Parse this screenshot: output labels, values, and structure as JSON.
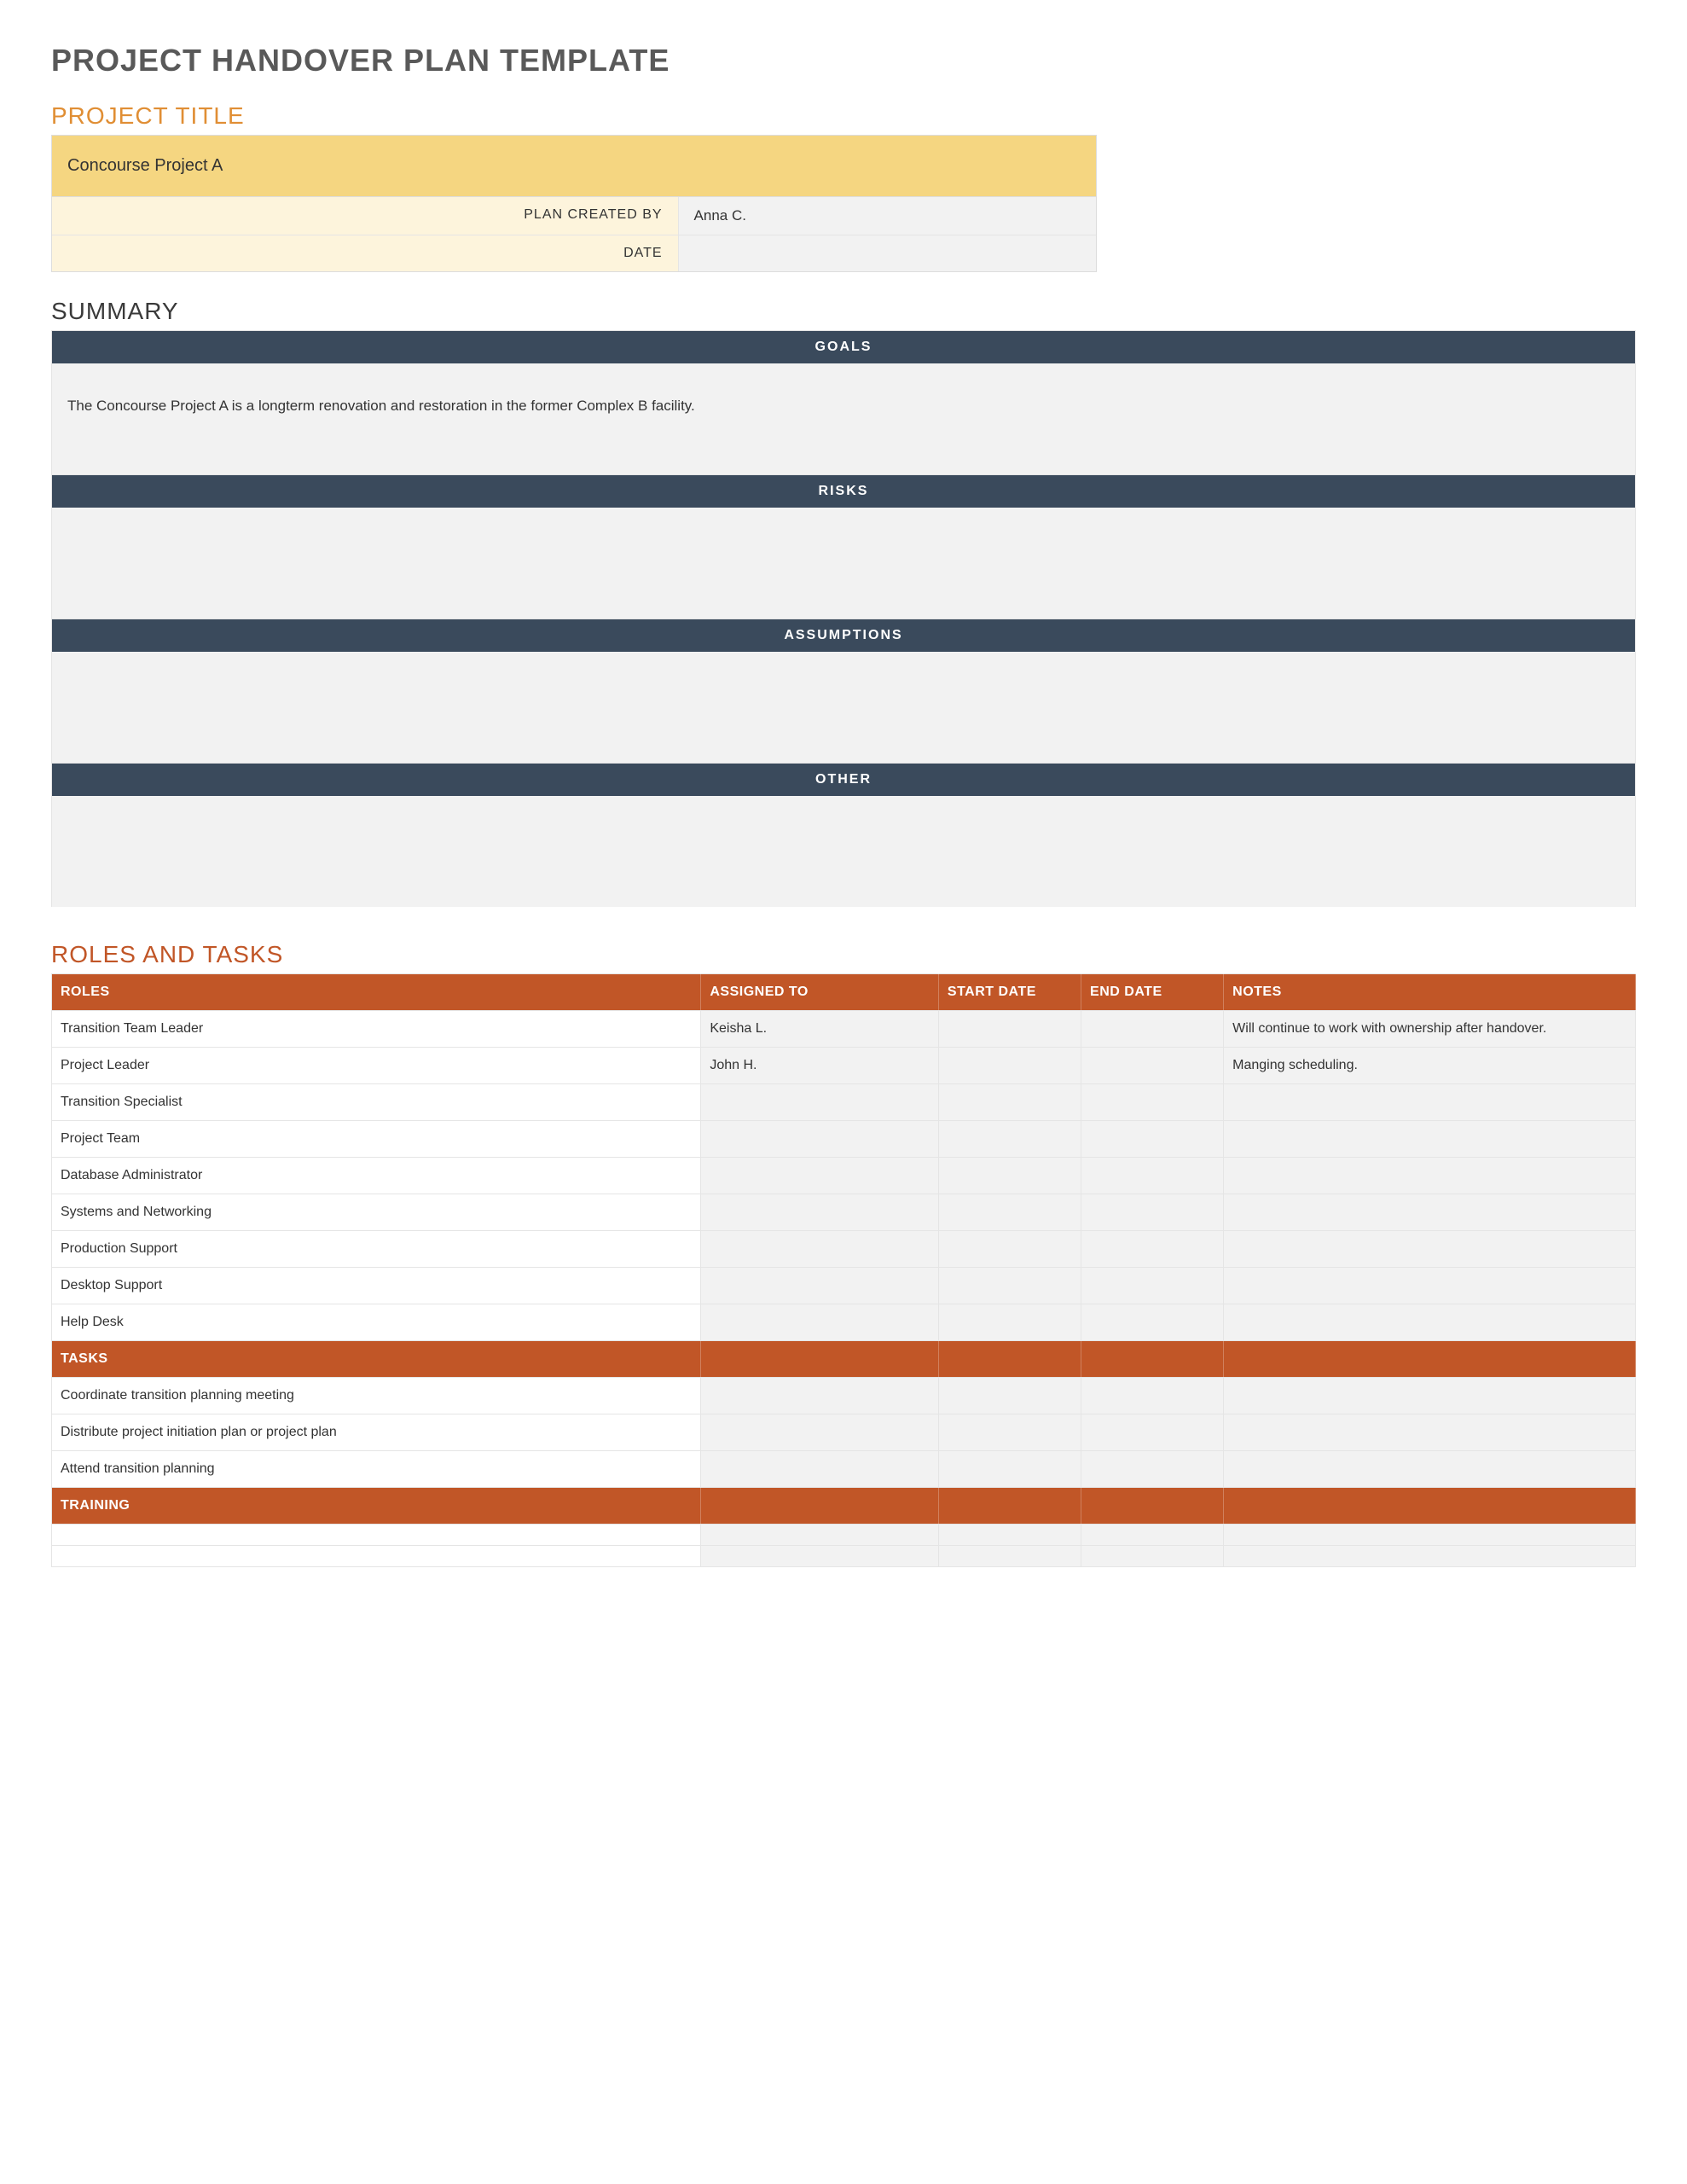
{
  "main_title": "PROJECT HANDOVER PLAN TEMPLATE",
  "project_title_label": "PROJECT TITLE",
  "project_name": "Concourse Project A",
  "meta": {
    "plan_created_by_label": "PLAN CREATED BY",
    "plan_created_by_value": "Anna C.",
    "date_label": "DATE",
    "date_value": ""
  },
  "summary": {
    "heading": "SUMMARY",
    "goals_label": "GOALS",
    "goals_text": "The Concourse Project A is a longterm renovation and restoration in the former Complex B facility.",
    "risks_label": "RISKS",
    "risks_text": "",
    "assumptions_label": "ASSUMPTIONS",
    "assumptions_text": "",
    "other_label": "OTHER",
    "other_text": ""
  },
  "roles_section": {
    "heading": "ROLES AND TASKS",
    "headers": {
      "roles": "ROLES",
      "assigned": "ASSIGNED TO",
      "start": "START DATE",
      "end": "END DATE",
      "notes": "NOTES"
    },
    "roles": [
      {
        "role": "Transition Team Leader",
        "assigned": "Keisha L.",
        "start": "",
        "end": "",
        "notes": "Will continue to work with ownership after handover."
      },
      {
        "role": "Project Leader",
        "assigned": "John H.",
        "start": "",
        "end": "",
        "notes": "Manging scheduling."
      },
      {
        "role": "Transition Specialist",
        "assigned": "",
        "start": "",
        "end": "",
        "notes": ""
      },
      {
        "role": "Project Team",
        "assigned": "",
        "start": "",
        "end": "",
        "notes": ""
      },
      {
        "role": "Database Administrator",
        "assigned": "",
        "start": "",
        "end": "",
        "notes": ""
      },
      {
        "role": "Systems and Networking",
        "assigned": "",
        "start": "",
        "end": "",
        "notes": ""
      },
      {
        "role": "Production Support",
        "assigned": "",
        "start": "",
        "end": "",
        "notes": ""
      },
      {
        "role": "Desktop Support",
        "assigned": "",
        "start": "",
        "end": "",
        "notes": ""
      },
      {
        "role": "Help Desk",
        "assigned": "",
        "start": "",
        "end": "",
        "notes": ""
      }
    ],
    "tasks_label": "TASKS",
    "tasks": [
      {
        "role": "Coordinate transition planning meeting",
        "assigned": "",
        "start": "",
        "end": "",
        "notes": ""
      },
      {
        "role": "Distribute project initiation plan or project plan",
        "assigned": "",
        "start": "",
        "end": "",
        "notes": ""
      },
      {
        "role": "Attend transition planning",
        "assigned": "",
        "start": "",
        "end": "",
        "notes": ""
      }
    ],
    "training_label": "TRAINING",
    "training": [
      {
        "role": "",
        "assigned": "",
        "start": "",
        "end": "",
        "notes": ""
      },
      {
        "role": "",
        "assigned": "",
        "start": "",
        "end": "",
        "notes": ""
      }
    ]
  }
}
